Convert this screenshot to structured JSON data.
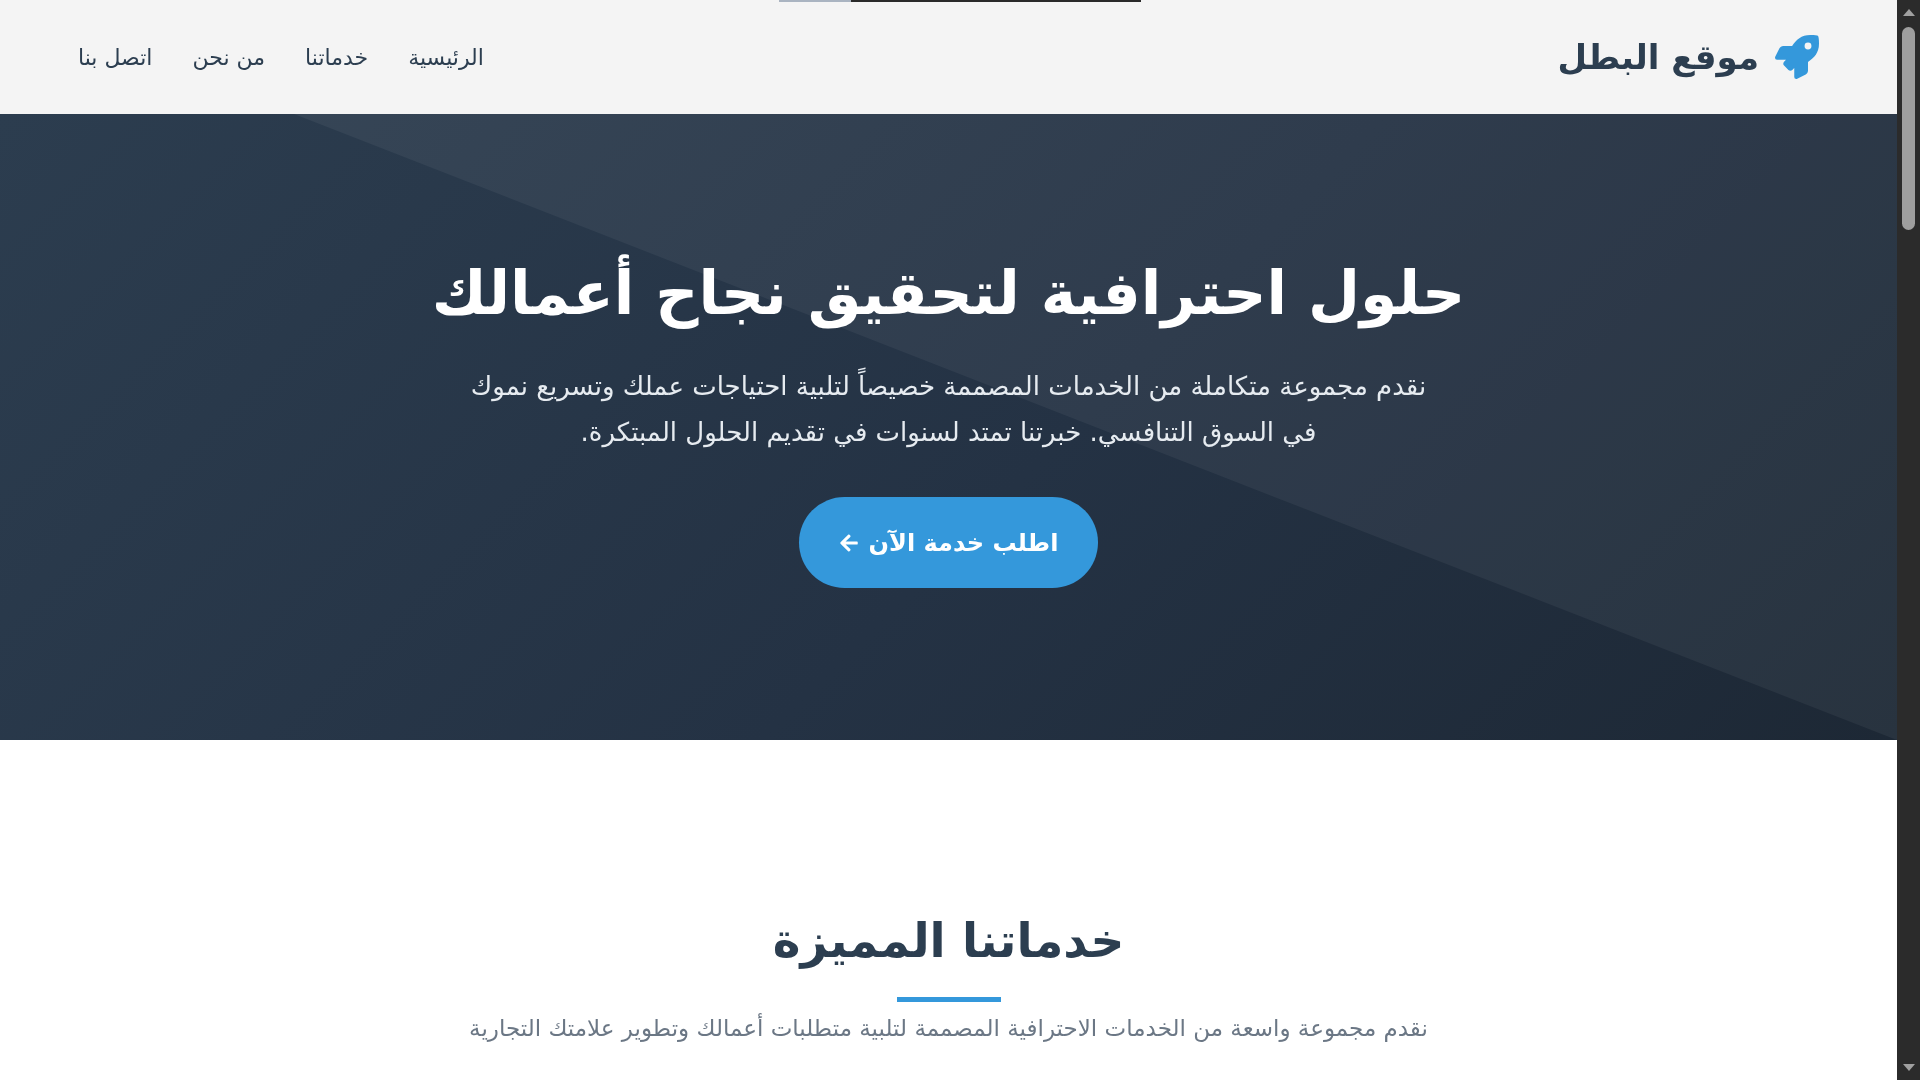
{
  "header": {
    "logo": {
      "text": "موقع البطل"
    },
    "nav": [
      {
        "label": "الرئيسية"
      },
      {
        "label": "خدماتنا"
      },
      {
        "label": "من نحن"
      },
      {
        "label": "اتصل بنا"
      }
    ]
  },
  "hero": {
    "title": "حلول احترافية لتحقيق نجاح أعمالك",
    "text": "نقدم مجموعة متكاملة من الخدمات المصممة خصيصاً لتلبية احتياجات عملك وتسريع نموك في السوق التنافسي. خبرتنا تمتد لسنوات في تقديم الحلول المبتكرة.",
    "button": {
      "label": "اطلب خدمة الآن"
    }
  },
  "services": {
    "title": "خدماتنا المميزة",
    "subtitle": "نقدم مجموعة واسعة من الخدمات الاحترافية المصممة لتلبية متطلبات أعمالك وتطوير علامتك التجارية"
  }
}
